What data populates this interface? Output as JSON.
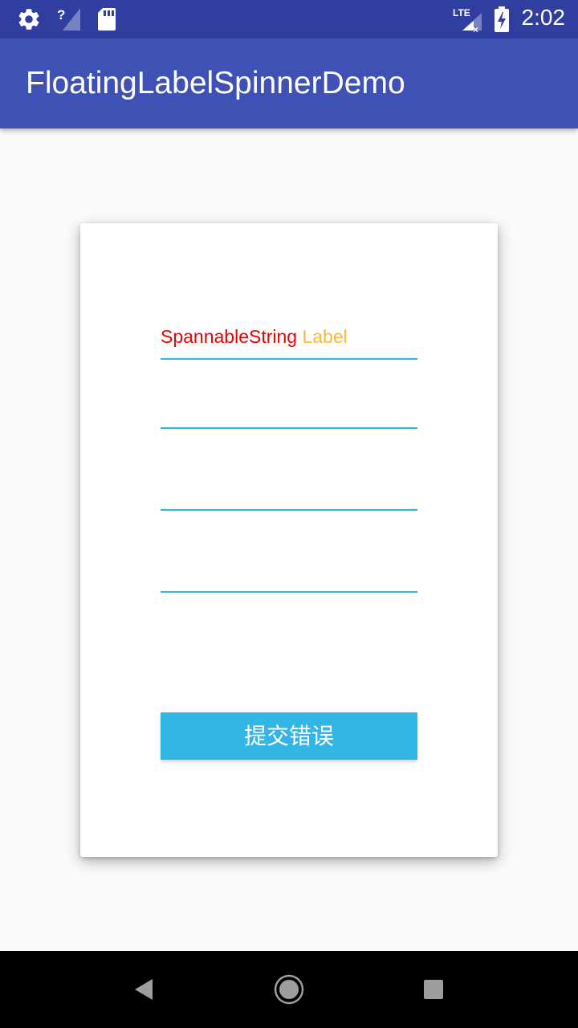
{
  "status_bar": {
    "time": "2:02",
    "network_label": "LTE",
    "icons": [
      "settings-icon",
      "no-signal-icon",
      "sd-card-icon",
      "lte-signal-icon",
      "battery-charging-icon"
    ]
  },
  "app_bar": {
    "title": "FloatingLabelSpinnerDemo"
  },
  "form": {
    "spinner_label_part1": "SpannableString",
    "spinner_label_part2": "Label",
    "submit_label": "提交错误"
  },
  "colors": {
    "status_bar": "#303f9f",
    "app_bar": "#3f51b5",
    "accent": "#33b5e5",
    "label_red": "#ee0000",
    "label_orange": "#ffb733"
  },
  "nav_bar": {
    "buttons": [
      "back-icon",
      "home-icon",
      "recents-icon"
    ]
  }
}
